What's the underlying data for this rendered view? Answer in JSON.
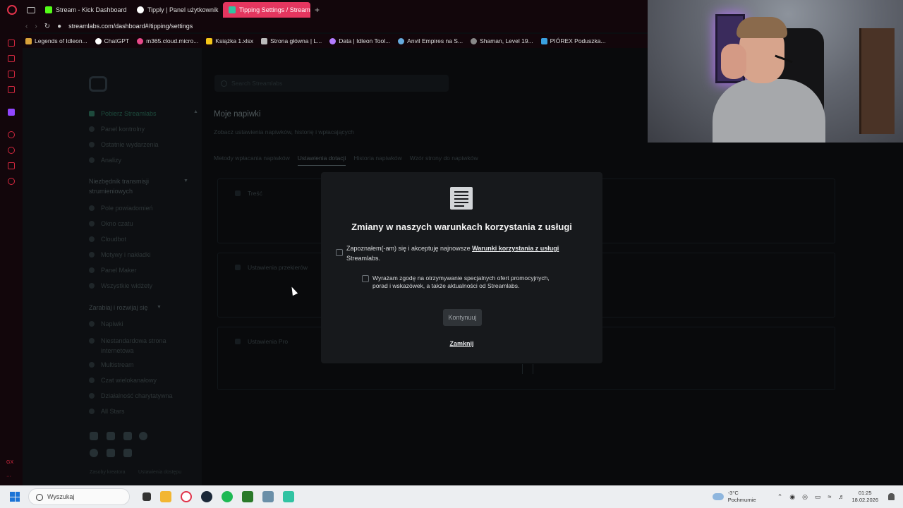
{
  "browser": {
    "tabs": [
      {
        "label": "Stream - Kick Dashboard",
        "color": "#53fc18",
        "active": false
      },
      {
        "label": "Tipply | Panel użytkownik",
        "color": "#ffffff",
        "active": false
      },
      {
        "label": "Tipping Settings / Streamla",
        "color": "#31c3a2",
        "active": true
      }
    ],
    "new_tab": "+",
    "url": "streamlabs.com/dashboard#/tipping/settings",
    "bookmarks": [
      {
        "label": "Legends of Idleon...",
        "color": "#d8a23a"
      },
      {
        "label": "ChatGPT",
        "color": "#ffffff"
      },
      {
        "label": "m365.cloud.micro...",
        "color": "#e84a8a"
      },
      {
        "label": "Książka 1.xlsx",
        "color": "#f5c518"
      },
      {
        "label": "Strona główna | L...",
        "color": "#bbbbbb"
      },
      {
        "label": "Data | Idleon Tool...",
        "color": "#b47cff"
      },
      {
        "label": "Anvil Empires na S...",
        "color": "#66aadd"
      },
      {
        "label": "Shaman, Level 19...",
        "color": "#888888"
      },
      {
        "label": "PIÓREX Poduszka...",
        "color": "#3aa0e0"
      }
    ],
    "rail_text": "GX"
  },
  "sidebar": {
    "items_top": [
      {
        "label": "Pobierz Streamlabs",
        "active": true
      },
      {
        "label": "Panel kontrolny"
      },
      {
        "label": "Ostatnie wydarzenia"
      },
      {
        "label": "Analizy"
      }
    ],
    "section1": "Niezbędnik transmisji strumieniowych",
    "items_mid": [
      {
        "label": "Pole powiadomień"
      },
      {
        "label": "Okno czatu"
      },
      {
        "label": "Cloudbot"
      },
      {
        "label": "Motywy i nakładki"
      },
      {
        "label": "Panel Maker"
      },
      {
        "label": "Wszystkie widżety"
      }
    ],
    "section2": "Zarabiaj i rozwijaj się",
    "items_bottom": [
      {
        "label": "Napiwki"
      },
      {
        "label": "Niestandardowa strona internetowa"
      },
      {
        "label": "Multistream"
      },
      {
        "label": "Czat wielokanałowy"
      },
      {
        "label": "Działalność charytatywna"
      },
      {
        "label": "All Stars"
      }
    ],
    "footer_left": "Zasoby kreatora",
    "footer_right": "Ustawienia dostępu"
  },
  "main": {
    "search_placeholder": "Search Streamlabs",
    "title": "Moje napiwki",
    "subtitle": "Zobacz ustawienia napiwków, historię i wpłacających",
    "tabs": [
      {
        "label": "Metody wpłacania napiwków"
      },
      {
        "label": "Ustawienia dotacji",
        "selected": true
      },
      {
        "label": "Historia napiwków"
      },
      {
        "label": "Wzór strony do napiwków"
      }
    ],
    "cards": [
      {
        "title": "Treść"
      },
      {
        "title": "Ustawienia przekierów"
      },
      {
        "title": "Ustawienia Pro"
      }
    ]
  },
  "modal": {
    "title": "Zmiany w naszych warunkach korzystania z usługi",
    "check1_text": "Zapoznałem(-am) się i akceptuję najnowsze ",
    "check1_link": "Warunki korzystania z usługi",
    "check1_suffix": "Streamlabs.",
    "check2_text": "Wyrażam zgodę na otrzymywanie specjalnych ofert promocyjnych, porad i wskazówek, a także aktualności od Streamlabs.",
    "continue_label": "Kontynuuj",
    "close_label": "Zamknij"
  },
  "taskbar": {
    "search_placeholder": "Wyszukaj",
    "weather_temp": "-3°C",
    "weather_desc": "Pochmurnie",
    "time": "01:25",
    "date": "18.02.2026"
  }
}
